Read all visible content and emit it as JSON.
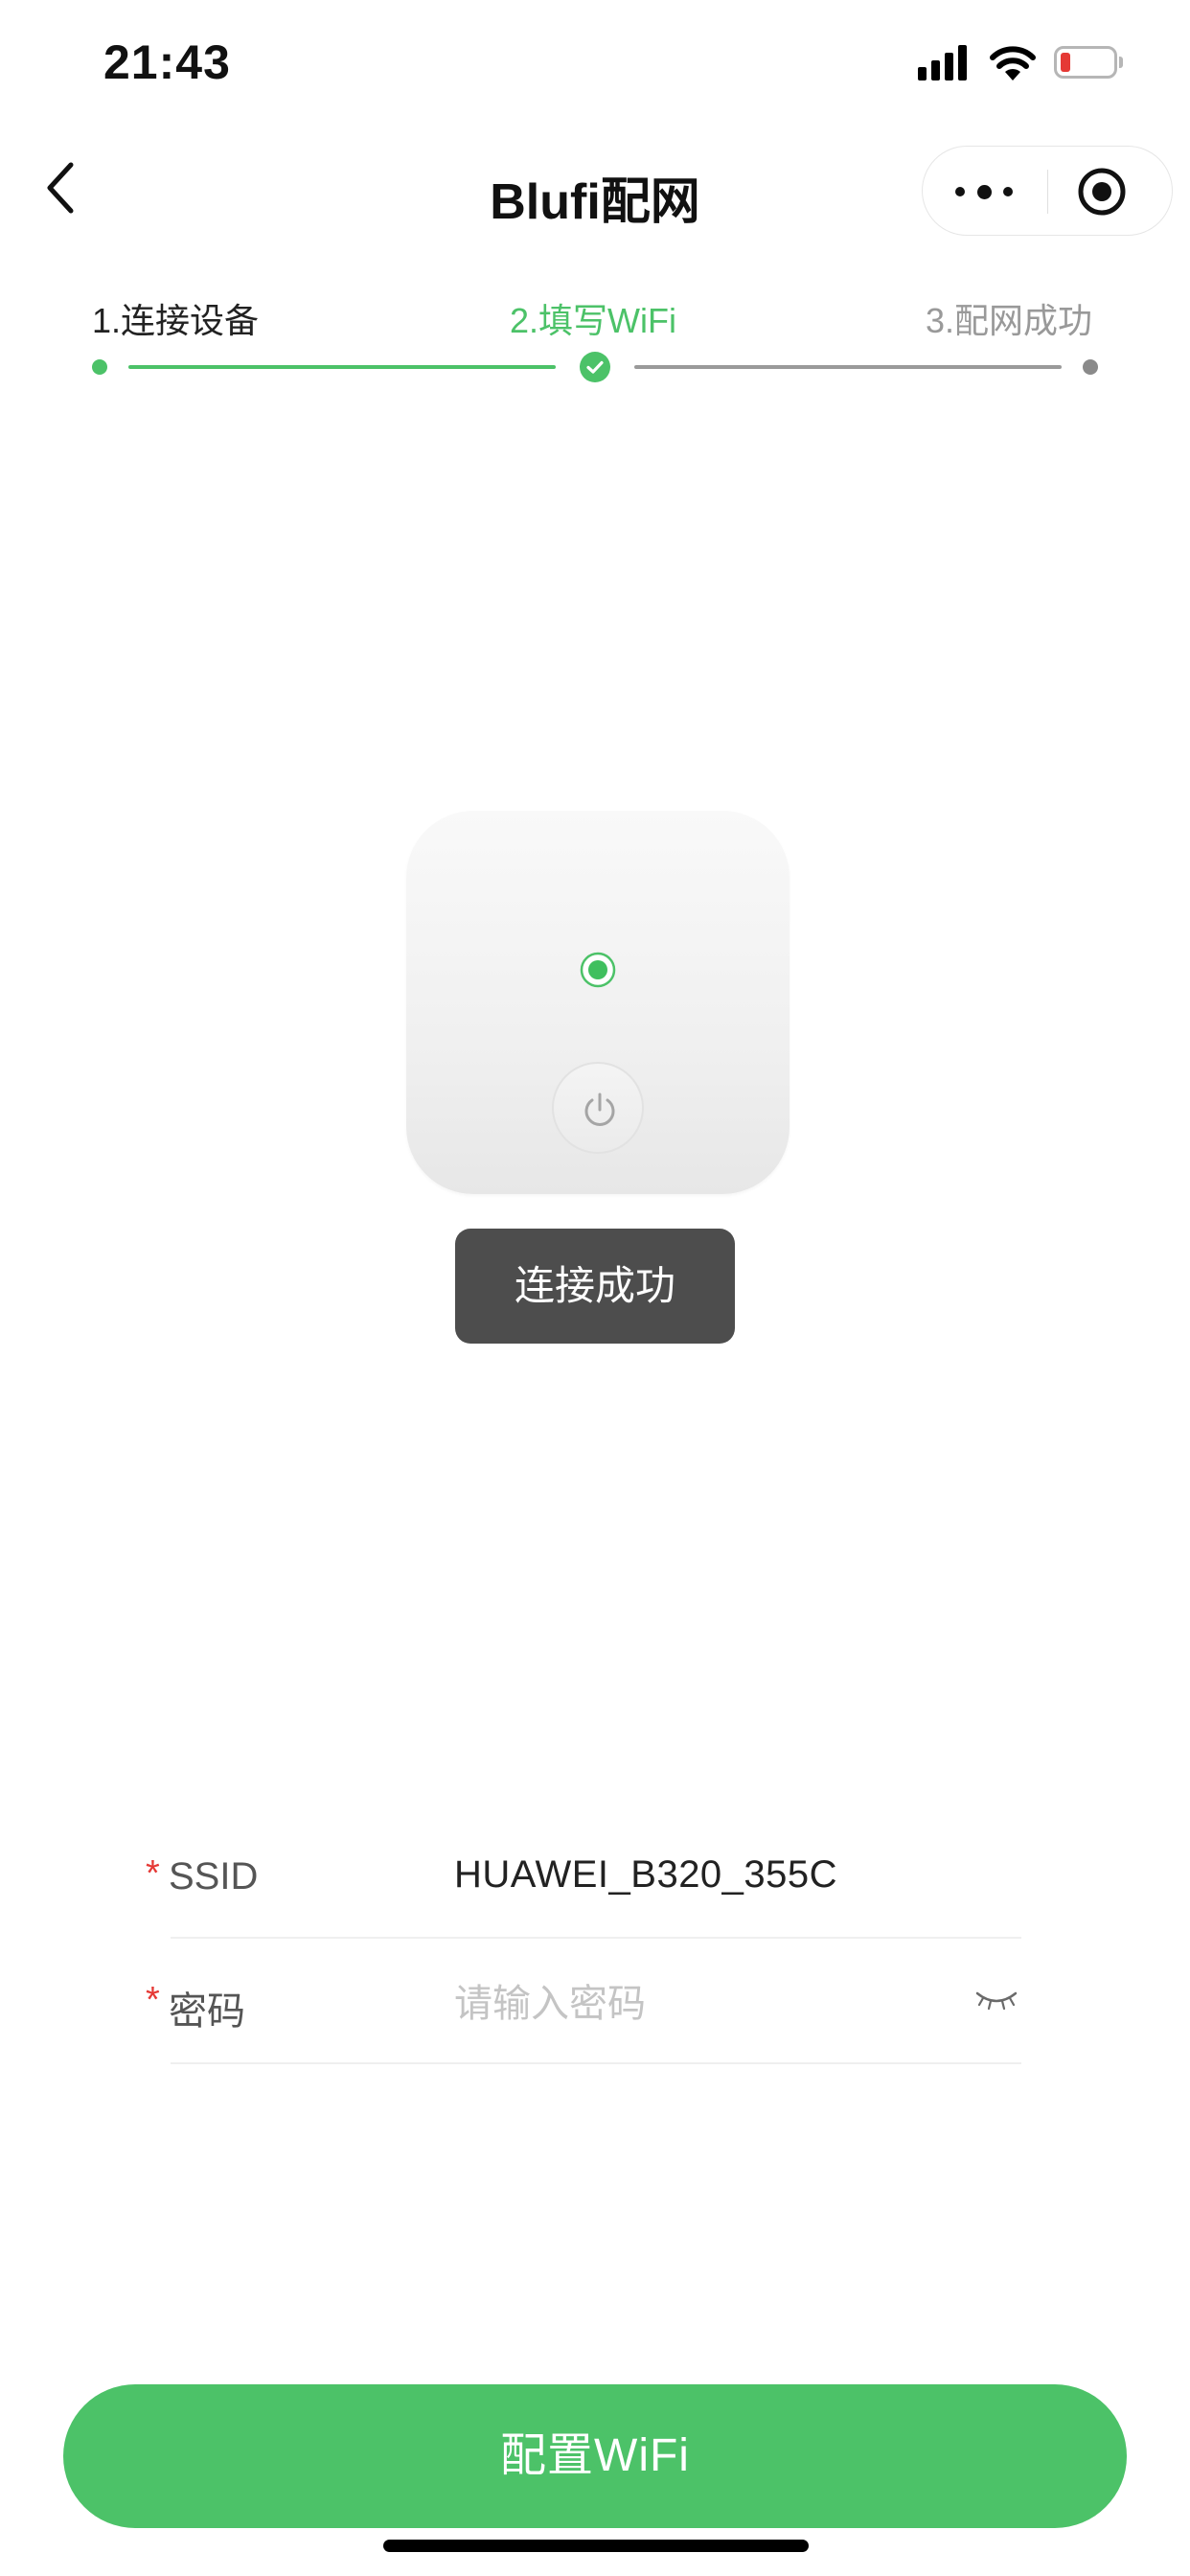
{
  "status_bar": {
    "time": "21:43",
    "icons": [
      "cellular-signal-icon",
      "wifi-icon",
      "battery-low-icon"
    ],
    "battery_color": "#e53935"
  },
  "nav": {
    "title": "Blufi配网",
    "back_icon": "chevron-left-icon",
    "more_icon": "more-dots-icon",
    "close_icon": "target-circle-icon"
  },
  "stepper": {
    "steps": [
      {
        "label": "1.连接设备",
        "state": "done"
      },
      {
        "label": "2.填写WiFi",
        "state": "current"
      },
      {
        "label": "3.配网成功",
        "state": "pending"
      }
    ],
    "active_color": "#4cc268",
    "inactive_color": "#9a9a9a"
  },
  "device": {
    "indicator_icon": "green-led-icon",
    "power_icon": "power-icon"
  },
  "toast": {
    "text": "连接成功"
  },
  "form": {
    "ssid": {
      "label": "SSID",
      "value": "HUAWEI_B320_355C",
      "required": true
    },
    "password": {
      "label": "密码",
      "placeholder": "请输入密码",
      "value": "",
      "required": true,
      "toggle_icon": "eye-closed-icon"
    },
    "required_mark": "*"
  },
  "footer": {
    "button_label": "配置WiFi",
    "button_color": "#4cc268"
  }
}
